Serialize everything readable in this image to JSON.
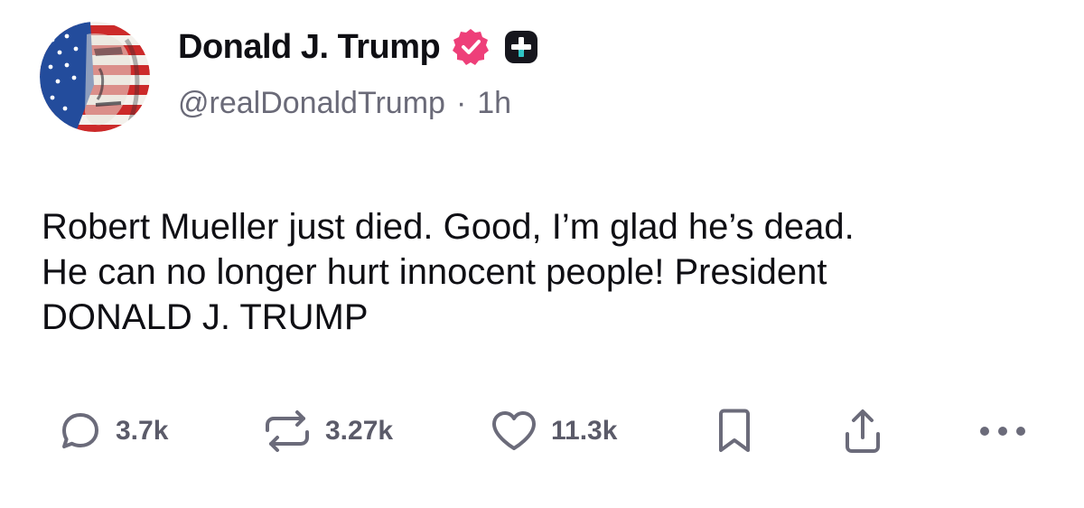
{
  "post": {
    "author": {
      "display_name": "Donald J. Trump",
      "handle": "@realDonaldTrump",
      "verified_icon": "verified-badge-icon",
      "plus_icon": "plus-badge-icon",
      "avatar_icon": "flag-portrait-avatar"
    },
    "separator": "·",
    "time_ago": "1h",
    "text": "Robert Mueller just died. Good, I’m glad he’s dead.\nHe can no longer hurt innocent people! President\nDONALD J. TRUMP",
    "actions": {
      "reply": {
        "icon": "reply-icon",
        "count": "3.7k"
      },
      "repost": {
        "icon": "repost-icon",
        "count": "3.27k"
      },
      "like": {
        "icon": "heart-icon",
        "count": "11.3k"
      },
      "bookmark": {
        "icon": "bookmark-icon"
      },
      "share": {
        "icon": "share-icon"
      },
      "more": {
        "icon": "more-icon"
      }
    }
  },
  "colors": {
    "text": "#0f0f14",
    "muted": "#6a6a78",
    "icon": "#6b6b7a",
    "verified": "#ee3f79",
    "plus_badge": "#16161d",
    "plus_accent": "#2ec4c4"
  }
}
